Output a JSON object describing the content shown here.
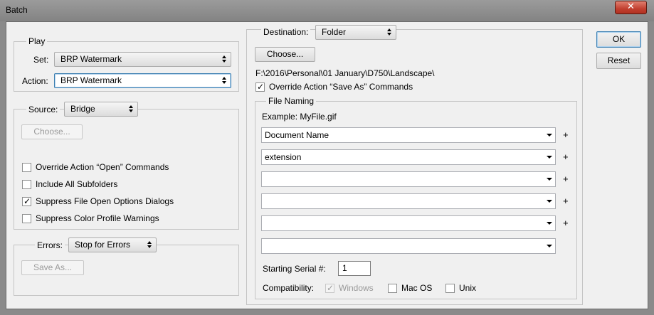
{
  "window": {
    "title": "Batch",
    "close_glyph": "✕"
  },
  "play": {
    "title": "Play",
    "set_label": "Set:",
    "set_value": "BRP Watermark",
    "action_label": "Action:",
    "action_value": "BRP Watermark"
  },
  "source": {
    "label": "Source:",
    "value": "Bridge",
    "choose_label": "Choose...",
    "options": [
      {
        "label": "Override Action “Open” Commands",
        "checked": false
      },
      {
        "label": "Include All Subfolders",
        "checked": false
      },
      {
        "label": "Suppress File Open Options Dialogs",
        "checked": true
      },
      {
        "label": "Suppress Color Profile Warnings",
        "checked": false
      }
    ]
  },
  "errors": {
    "label": "Errors:",
    "value": "Stop for Errors",
    "save_as_label": "Save As..."
  },
  "destination": {
    "label": "Destination:",
    "value": "Folder",
    "choose_label": "Choose...",
    "path": "F:\\2016\\Personal\\01 January\\D750\\Landscape\\",
    "override_label": "Override Action “Save As” Commands",
    "override_checked": true
  },
  "file_naming": {
    "title": "File Naming",
    "example": "Example: MyFile.gif",
    "fields": [
      "Document Name",
      "extension",
      "",
      "",
      "",
      ""
    ],
    "plus": "+",
    "serial_label": "Starting Serial #:",
    "serial_value": "1",
    "compat_label": "Compatibility:",
    "compat": [
      {
        "label": "Windows",
        "checked": true,
        "disabled": true
      },
      {
        "label": "Mac OS",
        "checked": false,
        "disabled": false
      },
      {
        "label": "Unix",
        "checked": false,
        "disabled": false
      }
    ]
  },
  "buttons": {
    "ok": "OK",
    "reset": "Reset"
  },
  "check_glyph": "✓"
}
